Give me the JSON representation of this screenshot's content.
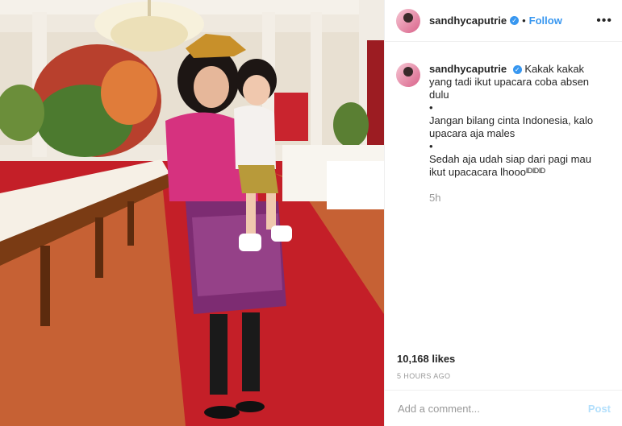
{
  "post": {
    "username": "sandhycaputrie",
    "follow_label": "Follow",
    "separator": "•",
    "more_label": "•••",
    "caption_lines": [
      "Kakak kakak yang tadi ikut upacara coba absen dulu",
      "•",
      "Jangan bilang cinta Indonesia, kalo upacara aja males",
      "•",
      "Sedah aja udah siap dari pagi mau ikut upacacara lhoooᴵᴰᴵᴰᴵᴰ"
    ],
    "caption_age": "5h",
    "likes": "10,168 likes",
    "time_ago": "5 HOURS AGO",
    "comment_placeholder": "Add a comment...",
    "post_label": "Post",
    "verified_mark": "✓"
  },
  "colors": {
    "accent": "#3897f0",
    "post_disabled": "#b2dffc",
    "text": "#262626",
    "muted": "#999999",
    "carpet": "#c8232c"
  }
}
